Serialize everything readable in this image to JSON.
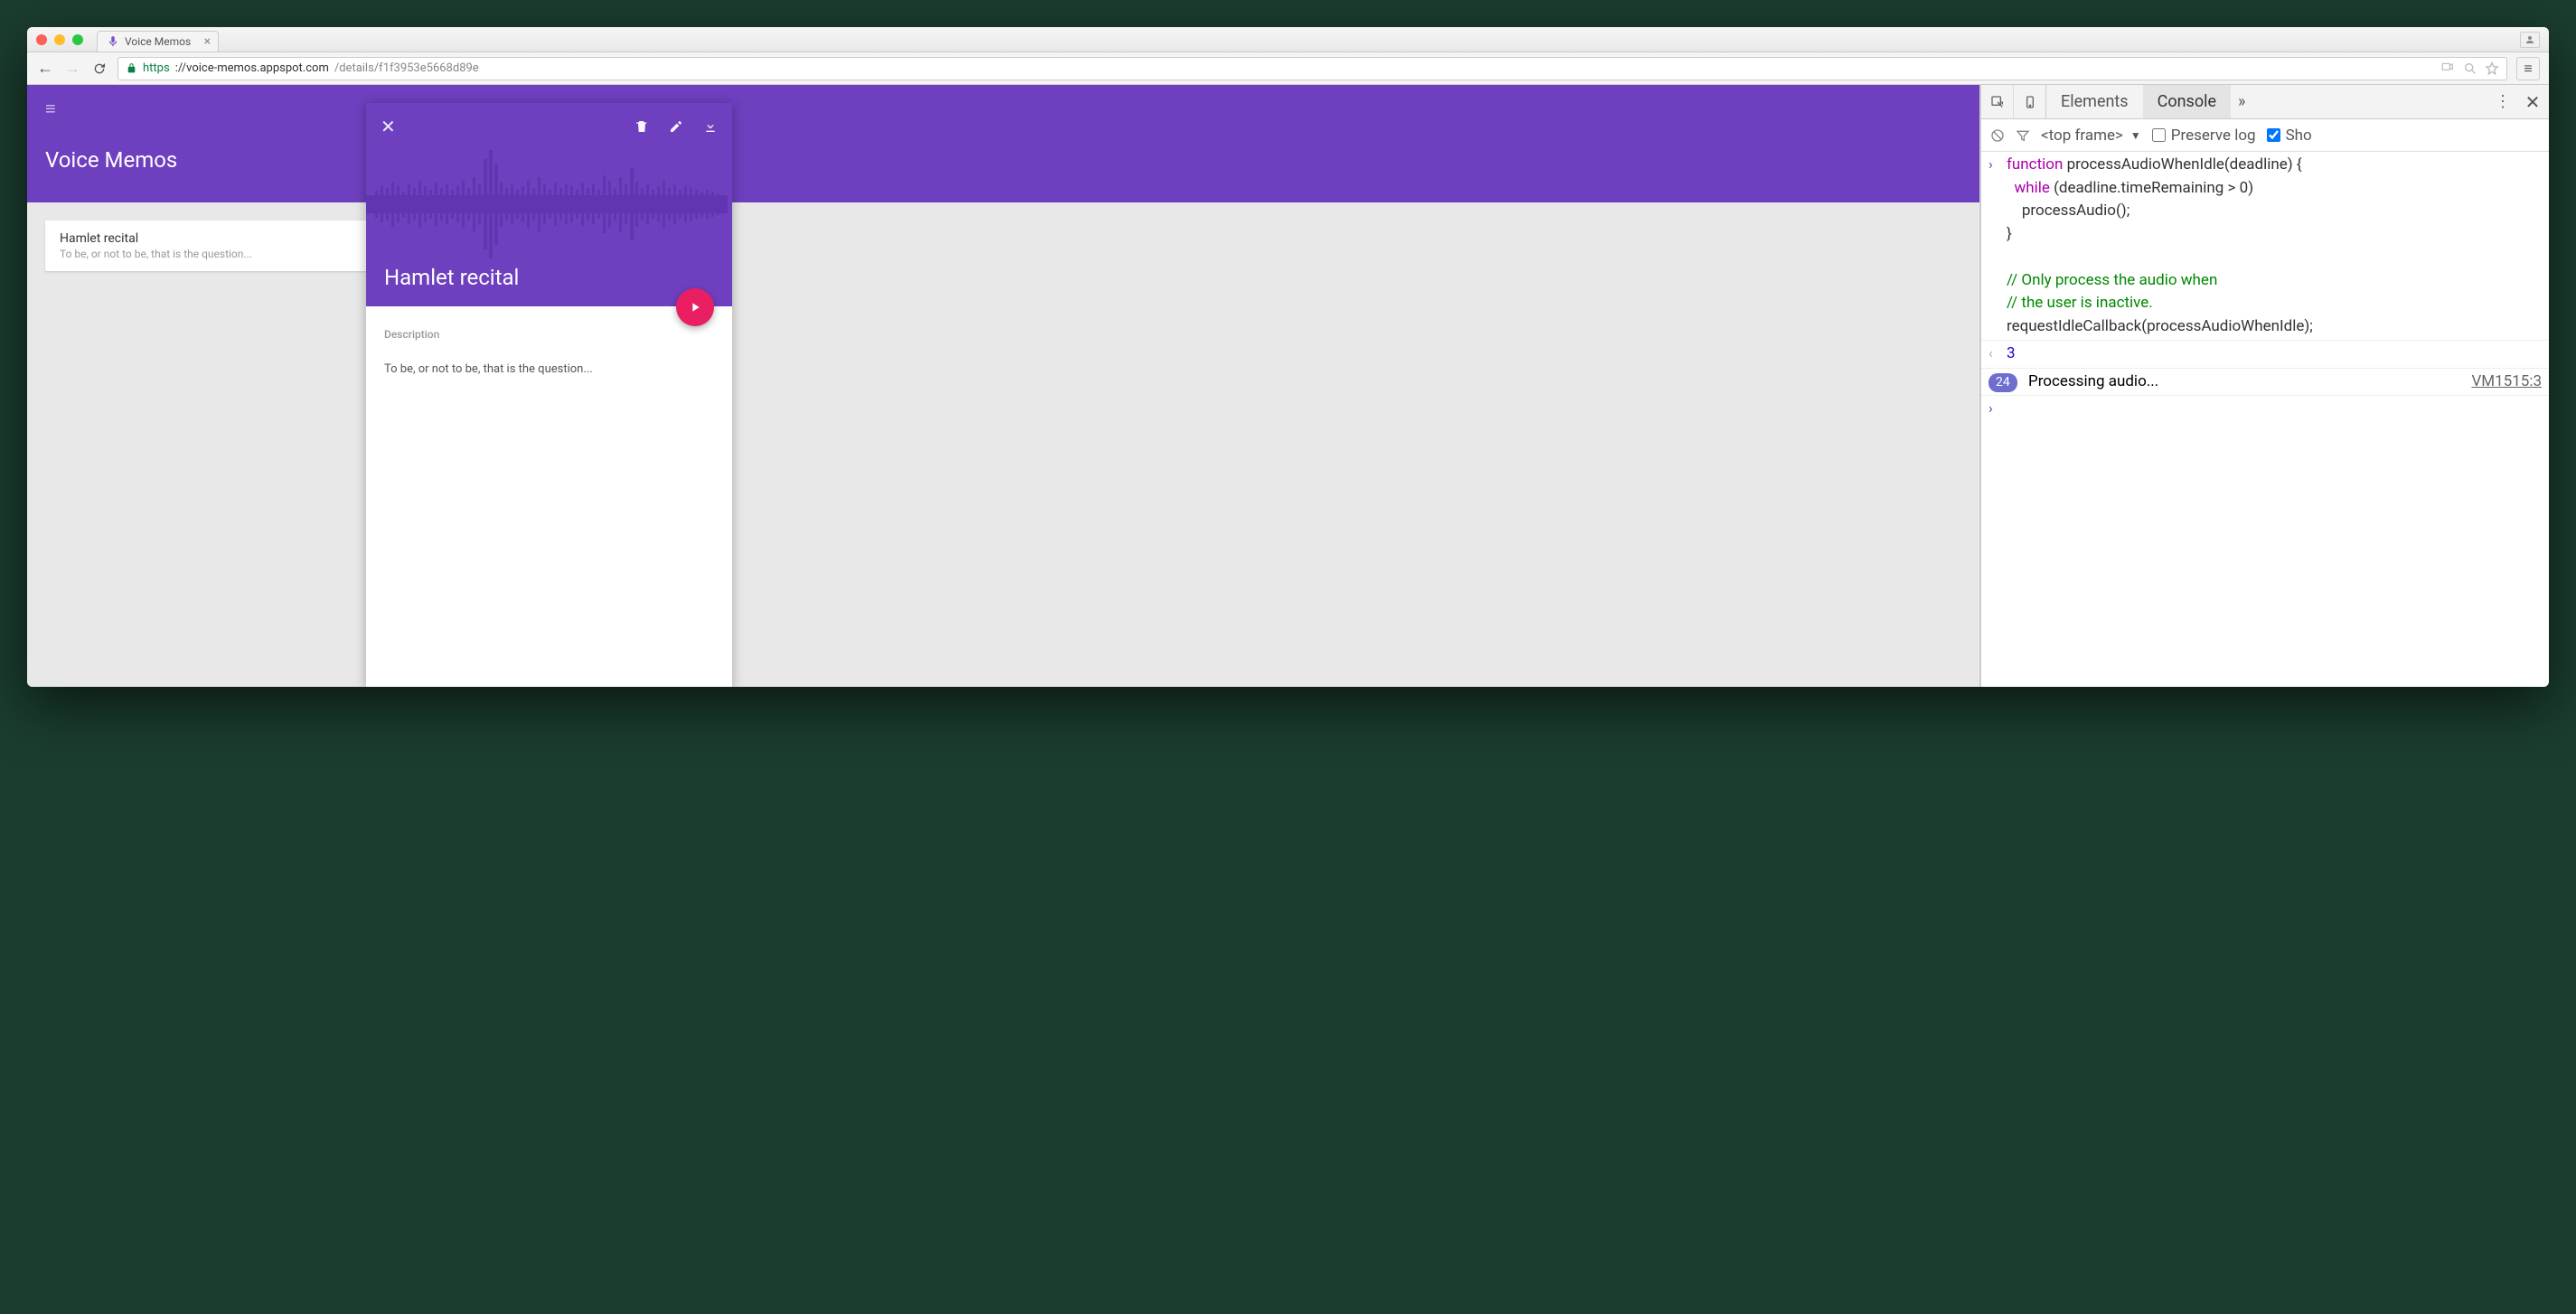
{
  "browser": {
    "tab": {
      "title": "Voice Memos"
    },
    "url": {
      "protocol": "https",
      "host": "://voice-memos.appspot.com",
      "path": "/details/f1f3953e5668d89e"
    }
  },
  "app": {
    "title": "Voice Memos",
    "memo_list": [
      {
        "title": "Hamlet recital",
        "subtitle": "To be, or not to be, that is the question..."
      }
    ],
    "detail": {
      "title": "Hamlet recital",
      "description_label": "Description",
      "description_text": "To be, or not to be, that is the question..."
    }
  },
  "devtools": {
    "tabs": {
      "elements": "Elements",
      "console": "Console",
      "more": "»"
    },
    "subbar": {
      "frame": "<top frame>",
      "preserve_log": "Preserve log",
      "preserve_checked": false,
      "show": "Sho",
      "show_checked": true
    },
    "console": {
      "code_lines": [
        [
          {
            "cls": "kw",
            "t": "function"
          },
          {
            "cls": "ident",
            "t": " processAudioWhenIdle(deadline) {"
          }
        ],
        [
          {
            "cls": "ident",
            "t": "  "
          },
          {
            "cls": "kw",
            "t": "while"
          },
          {
            "cls": "ident",
            "t": " (deadline.timeRemaining > 0)"
          }
        ],
        [
          {
            "cls": "ident",
            "t": "    processAudio();"
          }
        ],
        [
          {
            "cls": "ident",
            "t": "}"
          }
        ],
        [
          {
            "cls": "ident",
            "t": ""
          }
        ],
        [
          {
            "cls": "comment",
            "t": "// Only process the audio when"
          }
        ],
        [
          {
            "cls": "comment",
            "t": "// the user is inactive."
          }
        ],
        [
          {
            "cls": "ident",
            "t": "requestIdleCallback(processAudioWhenIdle);"
          }
        ]
      ],
      "result": "3",
      "log": {
        "count": "24",
        "message": "Processing audio...",
        "source": "VM1515:3"
      }
    }
  },
  "colors": {
    "primary": "#6e3fbf",
    "accent": "#e91e63"
  }
}
